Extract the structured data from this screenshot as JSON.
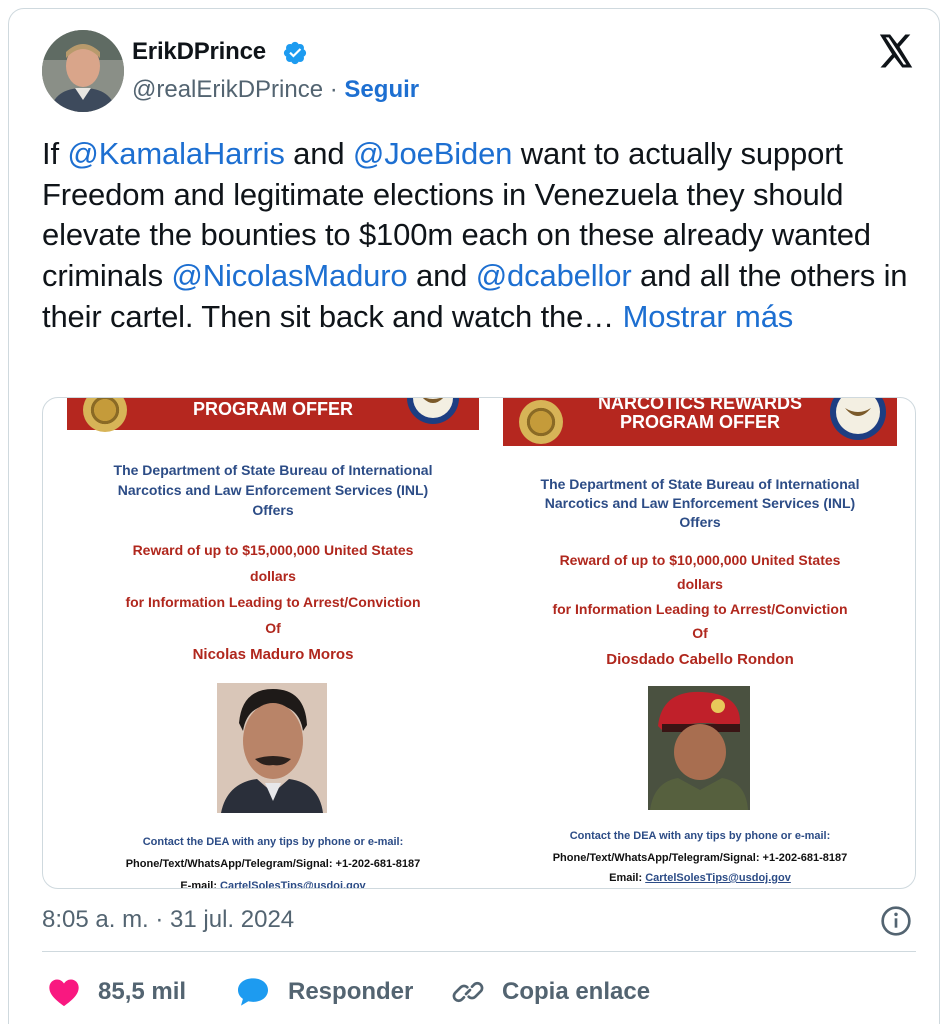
{
  "author": {
    "display_name": "ErikDPrince",
    "handle": "@realErikDPrince",
    "separator": "·",
    "follow_label": "Seguir"
  },
  "tweet": {
    "seg1": "If ",
    "mention1": "@KamalaHarris",
    "seg2": " and ",
    "mention2": "@JoeBiden",
    "seg3": " want to actually support Freedom and legitimate elections in Venezuela they should elevate the bounties to $100m each on these already wanted criminals ",
    "mention3": "@NicolasMaduro",
    "seg4": " and ",
    "mention4": "@dcabellor",
    "seg5": " and all the others in their cartel. Then sit back and watch the…",
    "show_more": "Mostrar más"
  },
  "media": {
    "poster1": {
      "banner": "PROGRAM OFFER",
      "dept_line1": "The Department of State Bureau of International",
      "dept_line2": "Narcotics and Law Enforcement Services (INL)",
      "offers": "Offers",
      "reward_line1": "Reward of up to $15,000,000 United States",
      "reward_line2": "dollars",
      "reward_line3": "for Information Leading to Arrest/Conviction",
      "of": "Of",
      "name": "Nicolas Maduro Moros",
      "contact": "Contact the DEA with any tips by phone or e-mail:",
      "phone": "Phone/Text/WhatsApp/Telegram/Signal: +1-202-681-8187",
      "email_label": "E-mail: ",
      "email": "CartelSolesTips@usdoj.gov"
    },
    "poster2": {
      "banner_line1": "NARCOTICS REWARDS",
      "banner_line2": "PROGRAM OFFER",
      "dept_line1": "The Department of State Bureau of International",
      "dept_line2": "Narcotics and Law Enforcement Services (INL)",
      "offers": "Offers",
      "reward_line1": "Reward of up to $10,000,000 United States",
      "reward_line2": "dollars",
      "reward_line3": "for Information Leading to Arrest/Conviction",
      "of": "Of",
      "name": "Diosdado Cabello Rondon",
      "contact": "Contact the DEA with any tips by phone or e-mail:",
      "phone": "Phone/Text/WhatsApp/Telegram/Signal: +1-202-681-8187",
      "email_label": "Email: ",
      "email": "CartelSolesTips@usdoj.gov"
    }
  },
  "timestamp": "8:05 a. m. · 31 jul. 2024",
  "actions": {
    "likes": "85,5 mil",
    "reply": "Responder",
    "copy_link": "Copia enlace"
  },
  "colors": {
    "link_blue": "#1d6fd1",
    "banner_red": "#b5271f",
    "like_pink": "#f91880",
    "reply_blue": "#1d9bf0"
  },
  "icons": {
    "verified": "verified-badge-icon",
    "platform": "x-logo-icon",
    "info": "info-icon",
    "like": "heart-icon",
    "reply": "speech-bubble-icon",
    "link": "link-icon"
  }
}
